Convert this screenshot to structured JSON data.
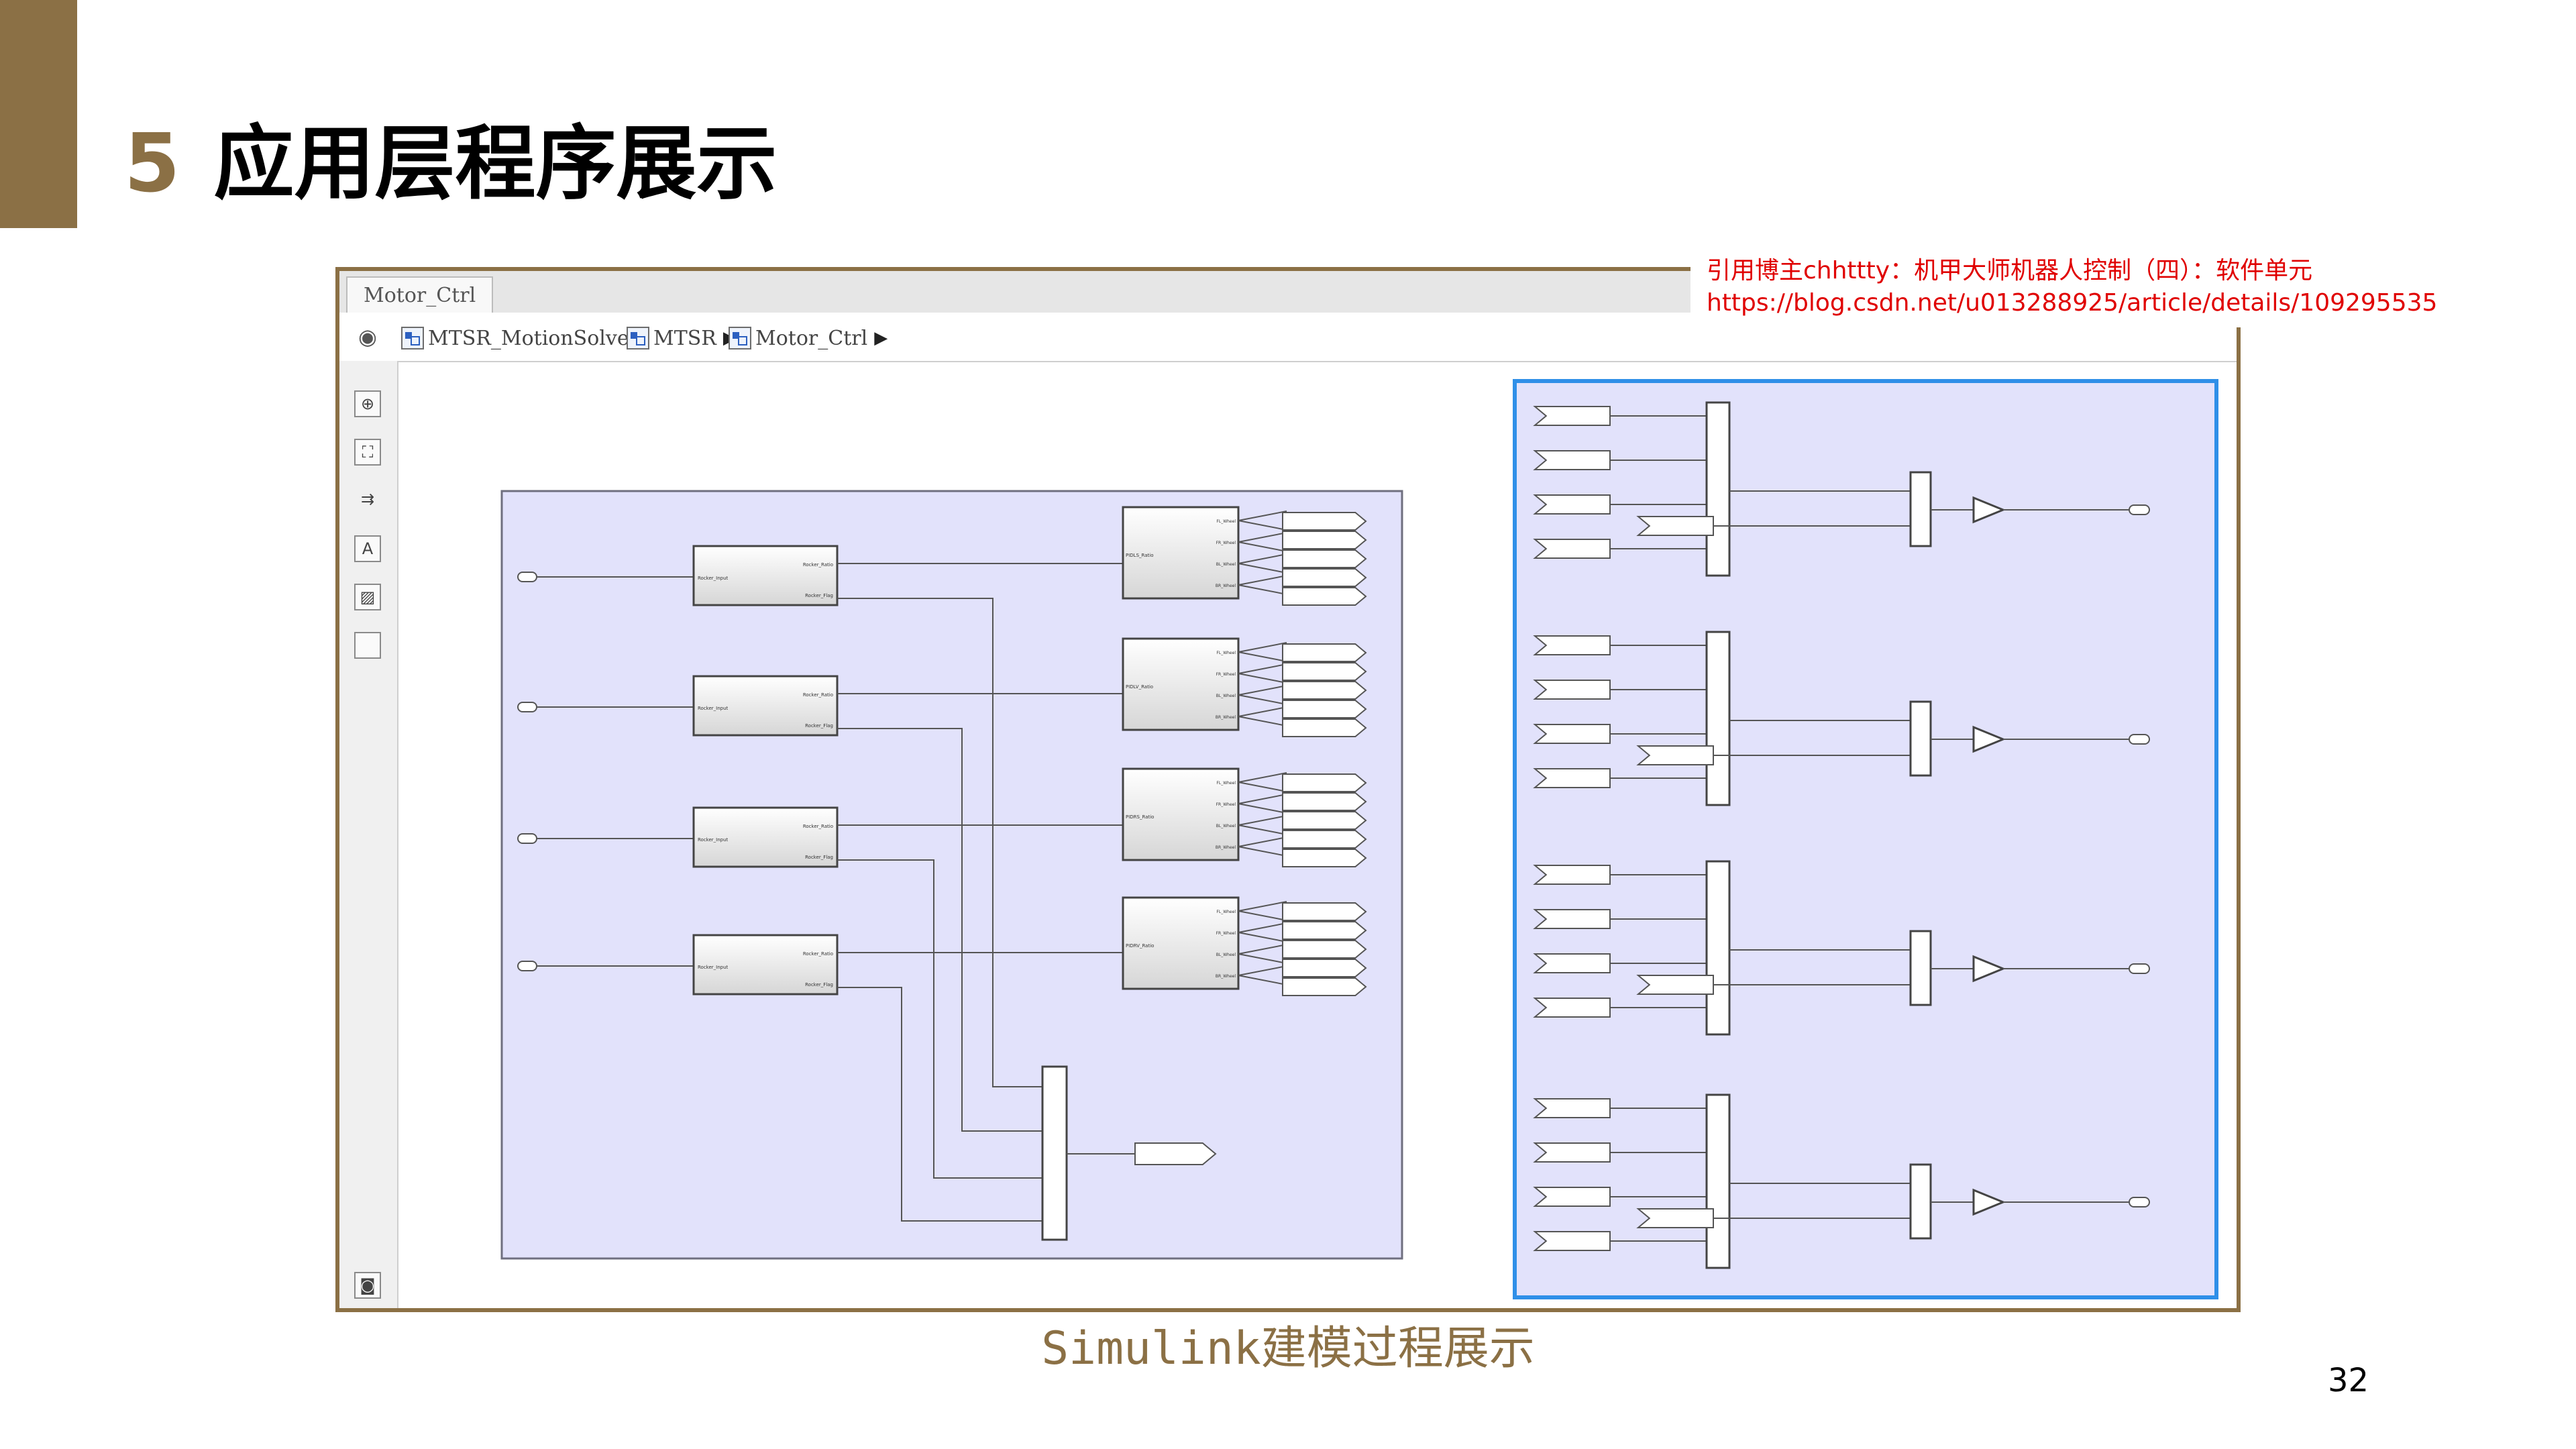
{
  "slide": {
    "number": "5",
    "title": "应用层程序展示",
    "caption": "Simulink建模过程展示",
    "page_number": "32",
    "accent_color": "#8b7045"
  },
  "citation": {
    "line1": "引用博主chhttty：机甲大师机器人控制（四）：软件单元",
    "line2": "https://blog.csdn.net/u013288925/article/details/109295535",
    "color": "#e00000"
  },
  "simulink": {
    "tab_title": "Motor_Ctrl",
    "breadcrumb": [
      "MTSR_MotionSolve",
      "MTSR",
      "Motor_Ctrl"
    ],
    "toolbar_icons": [
      "zoom-in-icon",
      "fit-to-view-icon",
      "signal-routing-icon",
      "annotation-icon",
      "image-icon",
      "area-icon",
      "screenshot-icon"
    ],
    "subsystem_colors": {
      "fill": "#e2e2fb",
      "border": "#6f6f7f",
      "selected_border": "#2f8fe8"
    },
    "left_area": {
      "input_blocks": [
        {
          "in_port": "Rocker_Input",
          "out_ports": [
            "Rocker_Ratio",
            "Rocker_Flag"
          ]
        },
        {
          "in_port": "Rocker_Input",
          "out_ports": [
            "Rocker_Ratio",
            "Rocker_Flag"
          ]
        },
        {
          "in_port": "Rocker_Input",
          "out_ports": [
            "Rocker_Ratio",
            "Rocker_Flag"
          ]
        },
        {
          "in_port": "Rocker_Input",
          "out_ports": [
            "Rocker_Ratio",
            "Rocker_Flag"
          ]
        }
      ],
      "wheel_blocks": [
        {
          "in_port": "PIDLS_Ratio",
          "out_ports": [
            "FL_Wheel",
            "FR_Wheel",
            "BL_Wheel",
            "BR_Wheel"
          ]
        },
        {
          "in_port": "PIDLV_Ratio",
          "out_ports": [
            "FL_Wheel",
            "FR_Wheel",
            "BL_Wheel",
            "BR_Wheel"
          ]
        },
        {
          "in_port": "PIDRS_Ratio",
          "out_ports": [
            "FL_Wheel",
            "FR_Wheel",
            "BL_Wheel",
            "BR_Wheel"
          ]
        },
        {
          "in_port": "PIDRV_Ratio",
          "out_ports": [
            "FL_Wheel",
            "FR_Wheel",
            "BL_Wheel",
            "BR_Wheel"
          ]
        }
      ]
    },
    "right_area": {
      "groups": 4,
      "inputs_per_group": 4
    }
  }
}
